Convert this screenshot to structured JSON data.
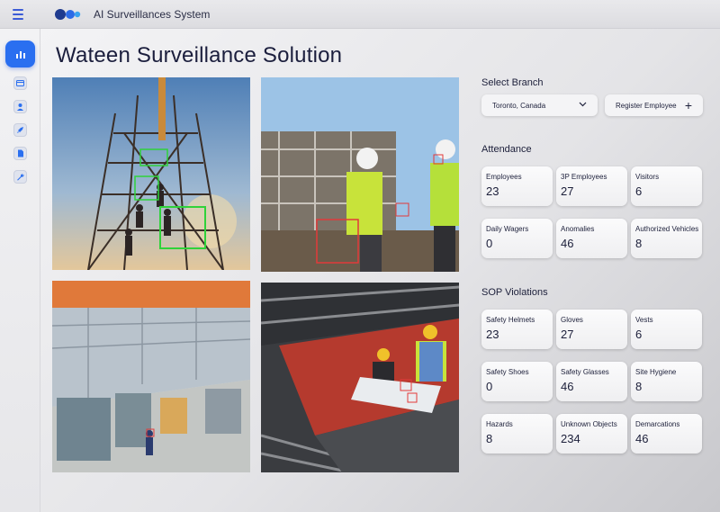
{
  "app": {
    "title": "AI Surveillances System"
  },
  "page": {
    "title": "Wateen Surveillance Solution"
  },
  "sidebar": {
    "items": [
      {
        "icon": "bar-chart-icon",
        "active": true
      },
      {
        "icon": "card-icon"
      },
      {
        "icon": "user-icon"
      },
      {
        "icon": "rocket-icon"
      },
      {
        "icon": "document-icon"
      },
      {
        "icon": "wrench-icon"
      }
    ]
  },
  "branch": {
    "label": "Select Branch",
    "selected": "Toronto, Canada",
    "register_label": "Register Employee"
  },
  "attendance": {
    "label": "Attendance",
    "cards": [
      {
        "label": "Employees",
        "value": "23"
      },
      {
        "label": "3P Employees",
        "value": "27"
      },
      {
        "label": "Visitors",
        "value": "6"
      },
      {
        "label": "Daily Wagers",
        "value": "0"
      },
      {
        "label": "Anomalies",
        "value": "46"
      },
      {
        "label": "Authorized Vehicles",
        "value": "8"
      }
    ]
  },
  "sop": {
    "label": "SOP Violations",
    "cards": [
      {
        "label": "Safety Helmets",
        "value": "23"
      },
      {
        "label": "Gloves",
        "value": "27"
      },
      {
        "label": "Vests",
        "value": "6"
      },
      {
        "label": "Safety Shoes",
        "value": "0"
      },
      {
        "label": "Safety Glasses",
        "value": "46"
      },
      {
        "label": "Site Hygiene",
        "value": "8"
      },
      {
        "label": "Hazards",
        "value": "8"
      },
      {
        "label": "Unknown Objects",
        "value": "234"
      },
      {
        "label": "Demarcations",
        "value": "46"
      }
    ]
  },
  "colors": {
    "accent": "#2a6ff0",
    "detection_green": "#2fd23a",
    "detection_red": "#e23a3a"
  }
}
